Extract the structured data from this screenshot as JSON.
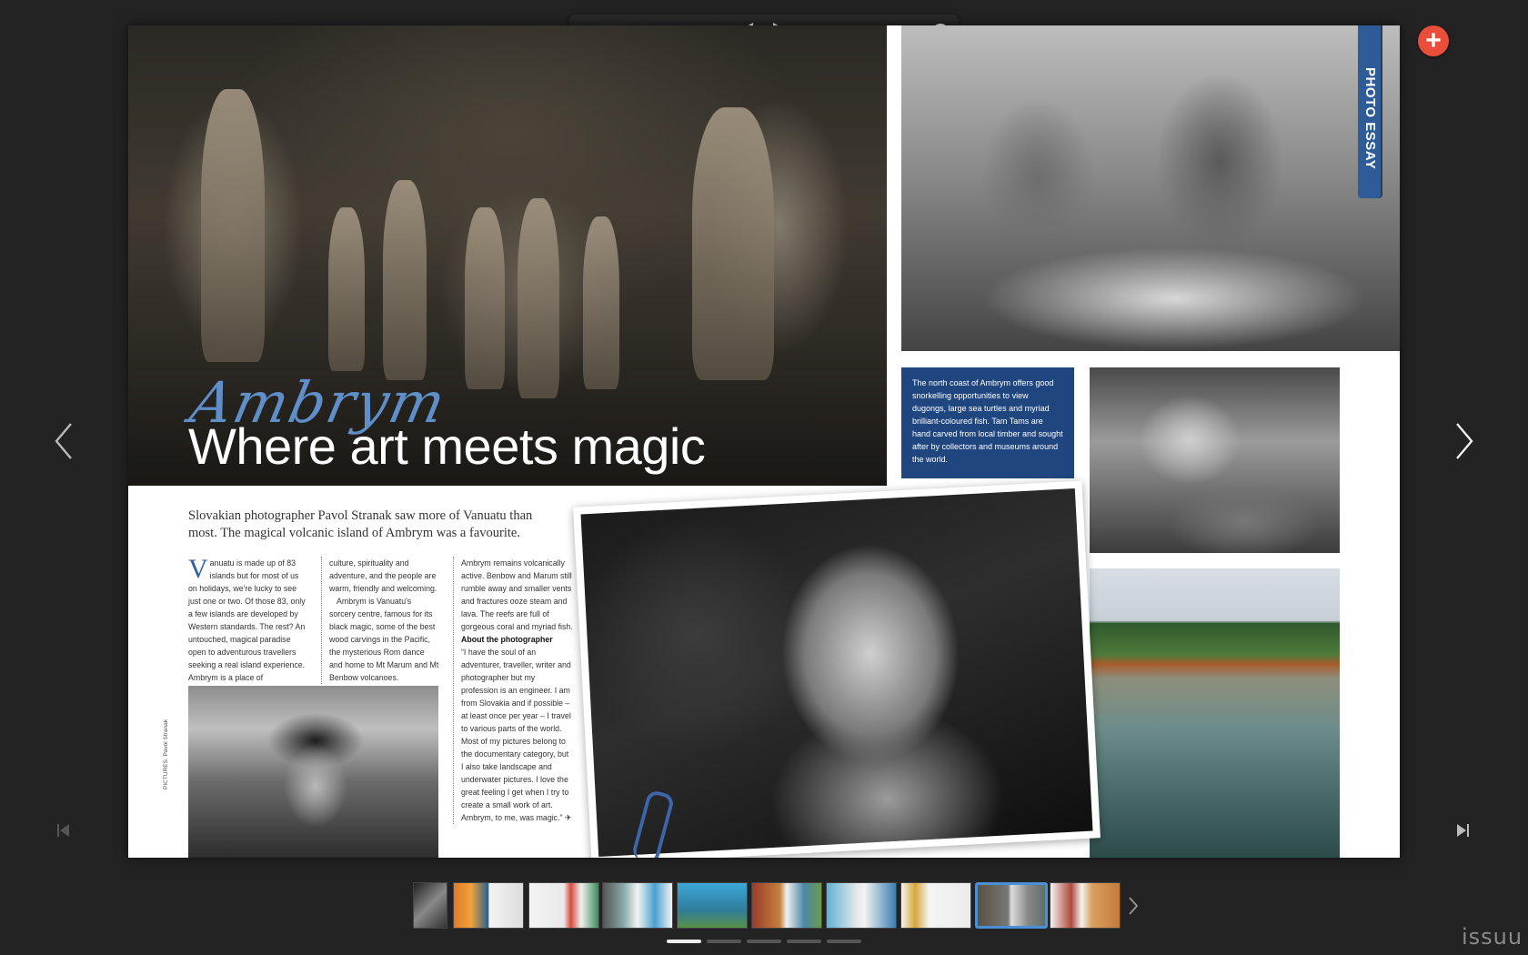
{
  "article": {
    "kicker": "Ambrym",
    "headline": "Where art meets magic",
    "intro": "Slovakian photographer Pavol Stranak saw more of Vanuatu than most. The magical volcanic island of Ambrym was a favourite.",
    "dropcap": "V",
    "col1": "anuatu is made up of 83 islands but for most of us on holidays, we're lucky to see just one or two. Of those 83, only a few islands are developed by Western standards. The rest? An untouched, magical paradise open to adventurous travellers seeking a real island experience. Ambrym is a place of",
    "col2a": "culture, spirituality and adventure, and the people are warm, friendly and welcoming.",
    "col2b": "Ambrym is Vanuatu's sorcery centre, famous for its black magic, some of the best wood carvings in the Pacific, the mysterious Rom dance and home to Mt Marum and Mt Benbow volcanoes.",
    "col3a": "Ambrym remains volcanically active. Benbow and Marum still rumble away and smaller vents and fractures ooze steam and lava. The reefs are full of gorgeous coral and myriad fish.",
    "col3_heading": "About the photographer",
    "col3b": "“I have the soul of an adventurer, traveller, writer and photographer but my profession is an engineer. I am from Slovakia and if possible – at least once per year – I travel to various parts of the world. Most of my pictures belong to the documentary category, but I also take landscape and underwater pictures. I love the great feeling I get when I try to create a small work of art. Ambrym, to me, was magic.” ✈",
    "credit": "PICTURES: Pavol Stranak",
    "section_tab": "PHOTO ESSAY",
    "caption": "The north coast of Ambrym offers good snorkelling opportunities to view dugongs, large sea turtles and myriad brilliant-coloured fish. Tam Tams are hand carved from local timber and sought after by collectors and museums around the world."
  },
  "toolbar": {
    "icons": [
      "zoom-slider",
      "single-page-view-icon",
      "previous-page-icon",
      "next-page-icon",
      "search-icon",
      "pages-overview-icon",
      "share-icon",
      "close-icon"
    ]
  },
  "navigation": {
    "left_arrow": "‹",
    "right_arrow": "›",
    "first_page": "first-page-icon",
    "last_page": "last-page-icon",
    "add": "+"
  },
  "thumbnails": {
    "count": 10,
    "active_index": 8,
    "next": "›"
  },
  "pager": {
    "dots": 5,
    "active": 0
  },
  "brand": "issuu",
  "colors": {
    "accent": "#4a90d9",
    "add_button": "#e94e3b",
    "tab": "#2e5c97",
    "kicker": "#5f8fc9"
  }
}
